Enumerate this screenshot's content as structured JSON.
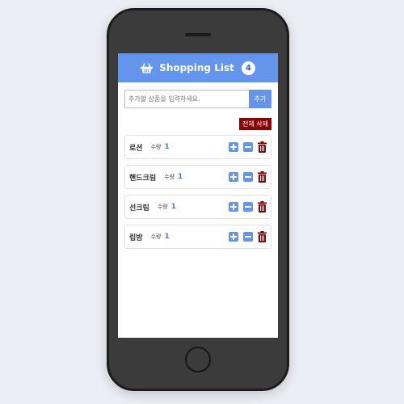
{
  "header": {
    "title": "Shopping List",
    "count": "4"
  },
  "add_form": {
    "placeholder": "추가할 상품을 입력하세요.",
    "button_label": "추가"
  },
  "clear_all_label": "전체 삭제",
  "items": [
    {
      "name": "로션",
      "qty_label": "수량",
      "qty": "1"
    },
    {
      "name": "핸드크림",
      "qty_label": "수량",
      "qty": "1"
    },
    {
      "name": "선크림",
      "qty_label": "수량",
      "qty": "1"
    },
    {
      "name": "립밤",
      "qty_label": "수량",
      "qty": "1"
    }
  ],
  "colors": {
    "primary": "#6495ed",
    "danger": "#8b0000",
    "background": "#eceef5"
  },
  "icons": {
    "header": "shopping-basket-icon",
    "increase": "plus-square-icon",
    "decrease": "minus-square-icon",
    "delete": "trash-icon"
  }
}
